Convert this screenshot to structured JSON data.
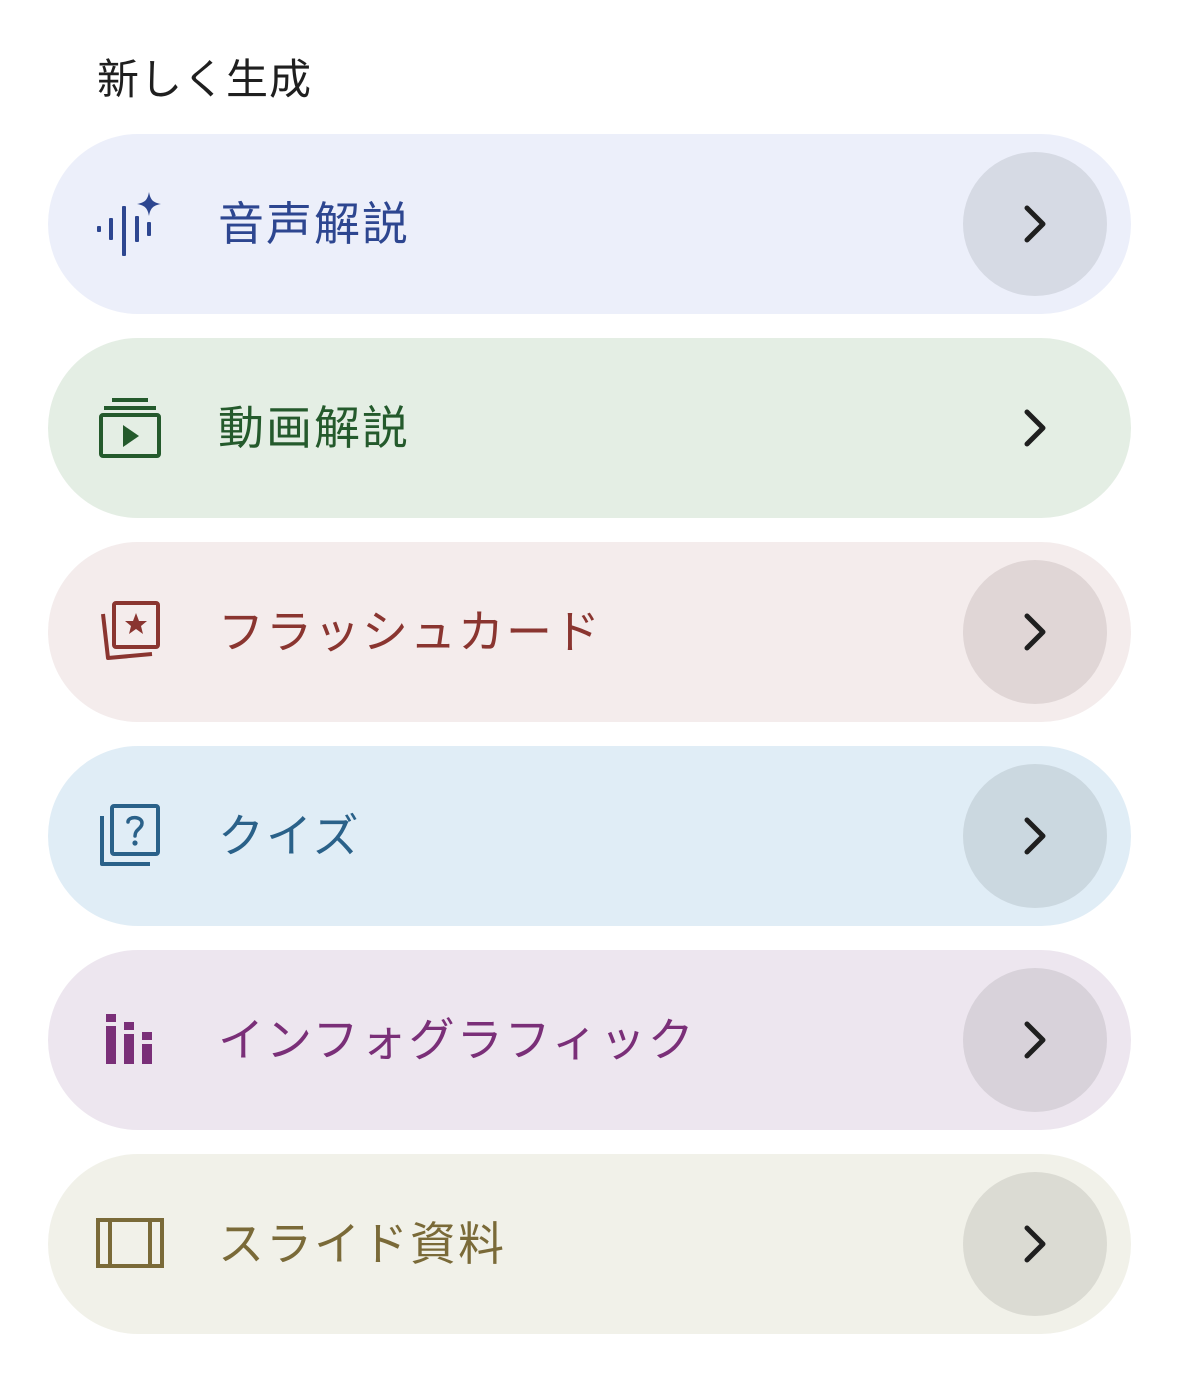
{
  "section": {
    "title": "新しく生成"
  },
  "items": [
    {
      "label": "音声解説",
      "icon": "audio-sparkle-icon",
      "bg": "#eceffa",
      "fg": "#2d4690",
      "circle": "#d6dae4"
    },
    {
      "label": "動画解説",
      "icon": "video-play-icon",
      "bg": "#e4eee4",
      "fg": "#245a2c",
      "circle": "transparent"
    },
    {
      "label": "フラッシュカード",
      "icon": "flashcard-star-icon",
      "bg": "#f4ecec",
      "fg": "#8a3530",
      "circle": "#e0d6d6"
    },
    {
      "label": "クイズ",
      "icon": "quiz-question-icon",
      "bg": "#e0edf6",
      "fg": "#2a6189",
      "circle": "#cbd8e0"
    },
    {
      "label": "インフォグラフィック",
      "icon": "infographic-bars-icon",
      "bg": "#ede6ef",
      "fg": "#7a2f78",
      "circle": "#d8d2da"
    },
    {
      "label": "スライド資料",
      "icon": "slide-deck-icon",
      "bg": "#f1f1e9",
      "fg": "#7a6a38",
      "circle": "#dbdbd3"
    }
  ],
  "chevron_icon": "chevron-right-icon",
  "chevron_color": "#1f1f1f"
}
